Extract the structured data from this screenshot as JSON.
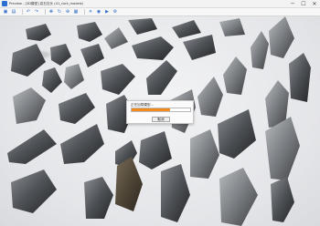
{
  "window": {
    "title": "Preview - [3D模型] 岩石石头 (41_rock_models)",
    "controls": {
      "minimize": "─",
      "maximize": "☐",
      "close": "✕"
    }
  },
  "toolbar": {
    "buttons": [
      {
        "name": "open-file-icon",
        "glyph": "▣"
      },
      {
        "name": "save-icon",
        "glyph": "▤"
      },
      {
        "name": "undo-icon",
        "glyph": "↶"
      },
      {
        "name": "redo-icon",
        "glyph": "↷"
      },
      {
        "name": "move-icon",
        "glyph": "✥"
      },
      {
        "name": "rotate-icon",
        "glyph": "↻"
      },
      {
        "name": "zoom-icon",
        "glyph": "⊕"
      },
      {
        "name": "grid-icon",
        "glyph": "▦"
      },
      {
        "name": "light-icon",
        "glyph": "☀"
      },
      {
        "name": "camera-icon",
        "glyph": "◉"
      },
      {
        "name": "render-icon",
        "glyph": "▶"
      },
      {
        "name": "settings-icon",
        "glyph": "⚙"
      }
    ]
  },
  "dialog": {
    "title": "正在加载模型...",
    "progress": 0.65,
    "cancel_label": "取消",
    "accent": "#f28a1e"
  }
}
